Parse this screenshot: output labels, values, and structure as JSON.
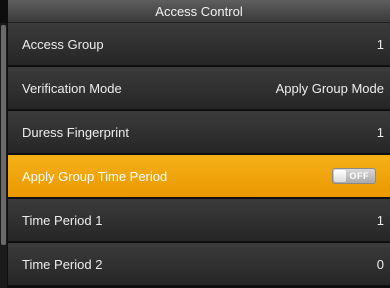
{
  "header": {
    "title": "Access Control"
  },
  "rows": [
    {
      "label": "Access Group",
      "value": "1"
    },
    {
      "label": "Verification Mode",
      "value": "Apply Group Mode"
    },
    {
      "label": "Duress Fingerprint",
      "value": "1"
    },
    {
      "label": "Apply Group Time Period",
      "toggle": "OFF"
    },
    {
      "label": "Time Period 1",
      "value": "1"
    },
    {
      "label": "Time Period 2",
      "value": "0"
    }
  ],
  "colors": {
    "selected": "#f5a500",
    "row": "#2e2e2e",
    "header": "#4a4a4a"
  },
  "selected_index": 3
}
